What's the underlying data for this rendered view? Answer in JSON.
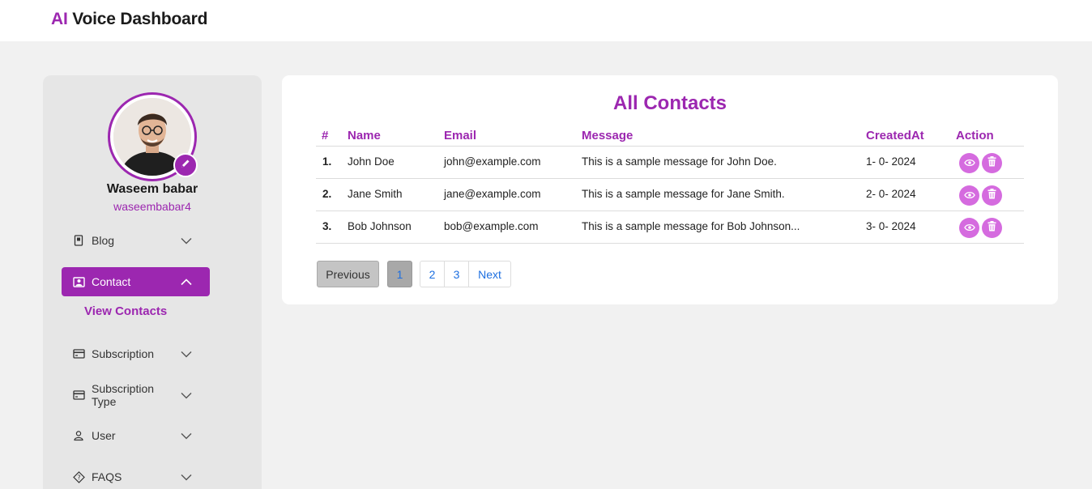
{
  "app": {
    "brand_accent": "AI",
    "brand_rest": " Voice Dashboard"
  },
  "colors": {
    "accent": "#9c27b0",
    "action_button": "#d56bdf",
    "link": "#1d6fe0"
  },
  "profile": {
    "name": "Waseem babar",
    "handle": "waseembabar4"
  },
  "sidebar": {
    "items": [
      {
        "label": "Blog",
        "icon": "document-icon",
        "expanded": false
      },
      {
        "label": "Contact",
        "icon": "contact-card-icon",
        "expanded": true,
        "active": true
      },
      {
        "label": "Subscription",
        "icon": "credit-card-icon",
        "expanded": false
      },
      {
        "label": "Subscription Type",
        "icon": "credit-card-icon",
        "expanded": false
      },
      {
        "label": "User",
        "icon": "user-icon",
        "expanded": false
      },
      {
        "label": "FAQS",
        "icon": "question-diamond-icon",
        "expanded": false
      }
    ],
    "contact_sub": "View Contacts"
  },
  "main": {
    "title": "All Contacts",
    "columns": [
      "#",
      "Name",
      "Email",
      "Message",
      "CreatedAt",
      "Action"
    ],
    "rows": [
      {
        "num": "1.",
        "name": "John Doe",
        "email": "john@example.com",
        "message": "This is a sample message for John Doe.",
        "created": "1- 0- 2024"
      },
      {
        "num": "2.",
        "name": "Jane Smith",
        "email": "jane@example.com",
        "message": "This is a sample message for Jane Smith.",
        "created": "2- 0- 2024"
      },
      {
        "num": "3.",
        "name": "Bob Johnson",
        "email": "bob@example.com",
        "message": "This is a sample message for Bob Johnson...",
        "created": "3- 0- 2024"
      }
    ],
    "actions": [
      "eye-icon",
      "trash-icon"
    ],
    "pagination": {
      "previous": "Previous",
      "pages": [
        "1",
        "2",
        "3"
      ],
      "current": "1",
      "next": "Next"
    }
  }
}
